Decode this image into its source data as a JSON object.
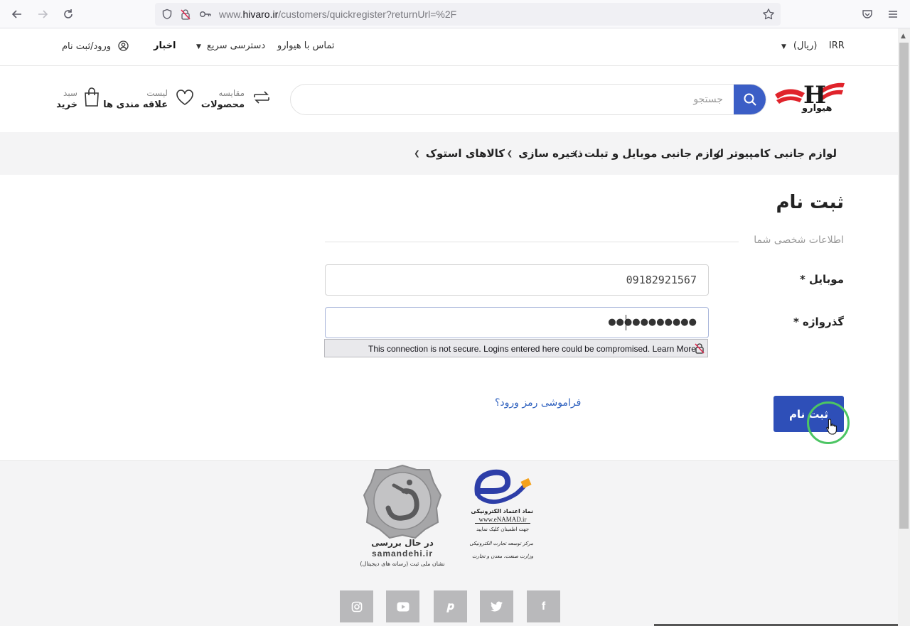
{
  "browser": {
    "url_prefix": "www.",
    "url_domain": "hivaro.ir",
    "url_path": "/customers/quickregister?returnUrl=%2F"
  },
  "topbar": {
    "currency": "IRR",
    "currency_name": "(ریال)",
    "contact": "تماس با هیوارو",
    "quick_access": "دسترسی سریع",
    "news": "اخبار",
    "login": "ورود/ثبت نام"
  },
  "header": {
    "logo_text": "هیوارو",
    "search_placeholder": "جستجو",
    "compare_top": "مقایسه",
    "compare_bottom": "محصولات",
    "wishlist_top": "لیست",
    "wishlist_bottom": "علاقه مندی ها",
    "cart_top": "سبد",
    "cart_bottom": "خرید"
  },
  "categories": [
    "لوازم جانبی کامپیوتر",
    "لوازم جانبی موبایل و تبلت",
    "ذخیره سازی",
    "کالاهای استوک"
  ],
  "form": {
    "title": "ثبت نام",
    "section": "اطلاعات شخصی شما",
    "mobile_label": "موبایل *",
    "mobile_value": "09182921567",
    "password_label": "گذرواژه *",
    "password_mask": "●●●●●●●●●●●",
    "warning": "This connection is not secure. Logins entered here could be compromised.",
    "warning_link": "Learn More",
    "forgot": "فراموشی رمز ورود؟",
    "submit": "ثبت نام"
  },
  "footer": {
    "samandehi_status": "در حال بررسی",
    "samandehi_domain": "samandehi.ir",
    "samandehi_caption": "نشان ملی ثبت (رسانه های دیجیتال)",
    "enamad_title": "نماد اعتماد الکترونیکی",
    "enamad_domain": "www.eNAMAD.ir",
    "enamad_hint": "جهت اطمینان کلیک نمایید",
    "enamad_org1": "مرکز توسعه تجارت الکترونیکی",
    "enamad_org2": "وزارت صنعت، معدن و تجارت",
    "social": [
      "instagram-icon",
      "youtube-icon",
      "pinterest-icon",
      "twitter-icon",
      "facebook-icon"
    ]
  },
  "colors": {
    "primary": "#2e4fb8",
    "search_button": "#3b5ec6",
    "link": "#2c5fbe",
    "click_ring": "#4cc563"
  }
}
